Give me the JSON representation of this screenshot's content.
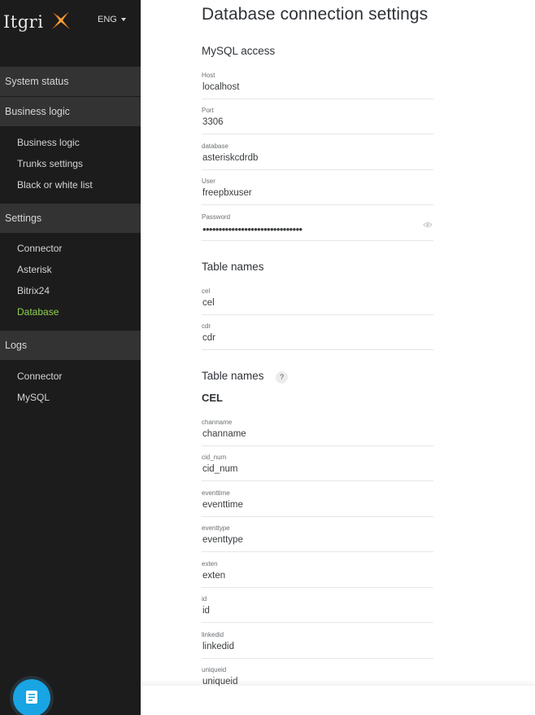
{
  "app": {
    "logo_text": "Itgri",
    "language": "ENG"
  },
  "sidebar": {
    "sections": [
      {
        "label": "System status",
        "items": []
      },
      {
        "label": "Business logic",
        "items": [
          {
            "label": "Business logic",
            "active": false
          },
          {
            "label": "Trunks settings",
            "active": false
          },
          {
            "label": "Black or white list",
            "active": false
          }
        ]
      },
      {
        "label": "Settings",
        "items": [
          {
            "label": "Connector",
            "active": false
          },
          {
            "label": "Asterisk",
            "active": false
          },
          {
            "label": "Bitrix24",
            "active": false
          },
          {
            "label": "Database",
            "active": true
          }
        ]
      },
      {
        "label": "Logs",
        "items": [
          {
            "label": "Connector",
            "active": false
          },
          {
            "label": "MySQL",
            "active": false
          }
        ]
      }
    ],
    "fab_icon": "document-icon"
  },
  "main": {
    "title": "Database connection settings",
    "mysql": {
      "title": "MySQL access",
      "fields": [
        {
          "label": "Host",
          "value": "localhost"
        },
        {
          "label": "Port",
          "value": "3306"
        },
        {
          "label": "database",
          "value": "asteriskcdrdb"
        },
        {
          "label": "User",
          "value": "freepbxuser"
        }
      ],
      "password": {
        "label": "Password",
        "masked": "•••••••••••••••••••••••••••••••"
      }
    },
    "tables": {
      "title": "Table names",
      "fields": [
        {
          "label": "cel",
          "value": "cel"
        },
        {
          "label": "cdr",
          "value": "cdr"
        }
      ]
    },
    "cel_columns": {
      "title": "Table names",
      "help": "?",
      "subtitle": "CEL",
      "fields": [
        {
          "label": "channame",
          "value": "channame"
        },
        {
          "label": "cid_num",
          "value": "cid_num"
        },
        {
          "label": "eventtime",
          "value": "eventtime"
        },
        {
          "label": "eventtype",
          "value": "eventtype"
        },
        {
          "label": "exten",
          "value": "exten"
        },
        {
          "label": "id",
          "value": "id"
        },
        {
          "label": "linkedid",
          "value": "linkedid"
        },
        {
          "label": "uniqueid",
          "value": "uniqueid"
        }
      ]
    }
  },
  "colors": {
    "sidebar_bg": "#1c1c1c",
    "section_bg": "#333333",
    "active_item": "#8fd14f",
    "fab": "#19a4e3",
    "logo_accent": "#f07a1a"
  }
}
